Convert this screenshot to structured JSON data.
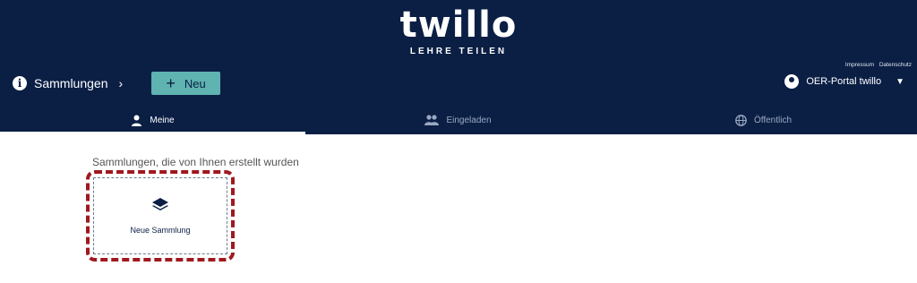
{
  "header": {
    "logo_text": "twillo",
    "logo_tagline": "LEHRE TEILEN",
    "meta_links": [
      "Impressum",
      "Datenschutz"
    ],
    "collections_label": "Sammlungen",
    "new_button_label": "Neu",
    "portal_label": "OER-Portal twillo"
  },
  "tabs": [
    {
      "label": "Meine",
      "icon": "person-icon",
      "active": true
    },
    {
      "label": "Eingeladen",
      "icon": "group-icon",
      "active": false
    },
    {
      "label": "Öffentlich",
      "icon": "globe-icon",
      "active": false
    }
  ],
  "main": {
    "section_title": "Sammlungen, die von Ihnen erstellt wurden",
    "new_collection_label": "Neue Sammlung"
  },
  "colors": {
    "header_bg": "#0b1f45",
    "accent_teal": "#5fb3b0",
    "highlight_red": "#a01820"
  }
}
